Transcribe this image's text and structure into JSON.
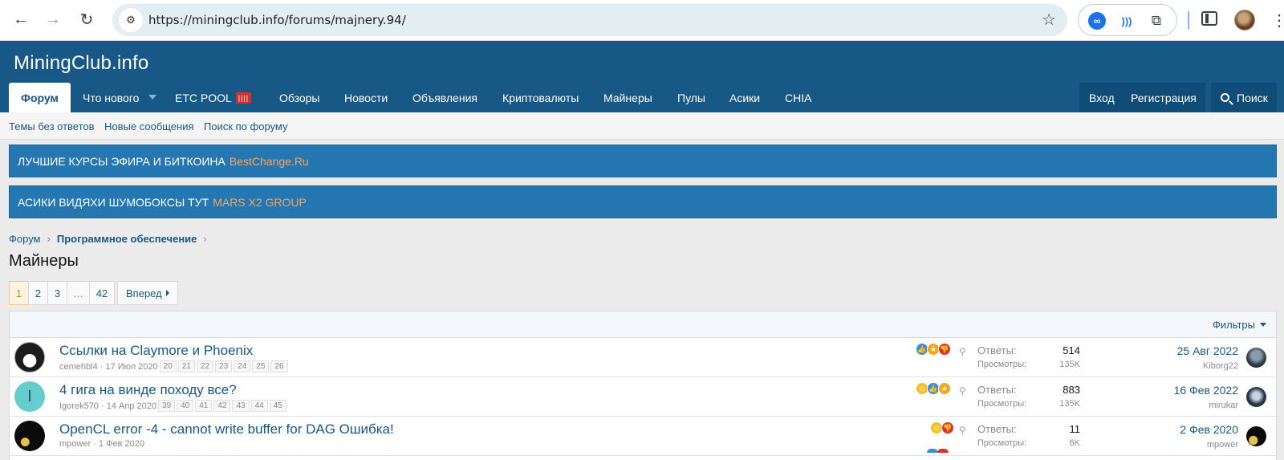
{
  "browser": {
    "url": "https://miningclub.info/forums/majnery.94/",
    "icons": [
      "back-arrow-icon",
      "forward-arrow-icon",
      "reload-icon",
      "site-settings-icon",
      "bookmark-star-icon",
      "extension-infinity-icon",
      "extension-wave-icon",
      "extensions-puzzle-icon",
      "side-panel-icon",
      "profile-avatar",
      "menu-kebab-icon"
    ]
  },
  "site": {
    "logo": "MiningClub.info",
    "nav": [
      {
        "label": "Форум"
      },
      {
        "label": "Что нового"
      },
      {
        "label": "ETC POOL"
      },
      {
        "label": "Обзоры"
      },
      {
        "label": "Новости"
      },
      {
        "label": "Объявления"
      },
      {
        "label": "Криптовалюты"
      },
      {
        "label": "Майнеры"
      },
      {
        "label": "Пулы"
      },
      {
        "label": "Асики"
      },
      {
        "label": "CHIA"
      }
    ],
    "account": {
      "login": "Вход",
      "register": "Регистрация"
    },
    "search_label": "Поиск"
  },
  "subnav": [
    "Темы без ответов",
    "Новые сообщения",
    "Поиск по форуму"
  ],
  "banners": [
    {
      "text": "ЛУЧШИЕ КУРСЫ ЭФИРА И БИТКОИНА",
      "link": "BestChange.Ru"
    },
    {
      "text": "АСИКИ ВИДЯХИ ШУМОБОКСЫ ТУТ",
      "link": "MARS X2 GROUP"
    }
  ],
  "breadcrumb": [
    "Форум",
    "Программное обеспечение"
  ],
  "page_title": "Майнеры",
  "pagination": {
    "pages": [
      "1",
      "2",
      "3",
      "…",
      "42"
    ],
    "current": "1",
    "next": "Вперед"
  },
  "filters_label": "Фильтры",
  "threads": [
    {
      "title": "Ссылки на Claymore и Phoenix",
      "author": "cemehbl4",
      "date": "17 Июл 2020",
      "pages": [
        "20",
        "21",
        "22",
        "23",
        "24",
        "25",
        "26"
      ],
      "replies_label": "Ответы:",
      "replies": "514",
      "views_label": "Просмотры:",
      "views": "135K",
      "last_date": "25 Авг 2022",
      "last_user": "Kiborg22"
    },
    {
      "title": "4 гига на винде походу все?",
      "author": "Igorek570",
      "avatar_letter": "I",
      "date": "14 Апр 2020",
      "pages": [
        "39",
        "40",
        "41",
        "42",
        "43",
        "44",
        "45"
      ],
      "replies_label": "Ответы:",
      "replies": "883",
      "views_label": "Просмотры:",
      "views": "135K",
      "last_date": "16 Фев 2022",
      "last_user": "mirukar"
    },
    {
      "title": "OpenCL error -4 - cannot write buffer for DAG Ошибка!",
      "author": "mpower",
      "date": "1 Фев 2020",
      "pages": [],
      "replies_label": "Ответы:",
      "replies": "11",
      "views_label": "Просмотры:",
      "views": "6K",
      "last_date": "2 Фев 2020",
      "last_user": "mpower"
    }
  ]
}
